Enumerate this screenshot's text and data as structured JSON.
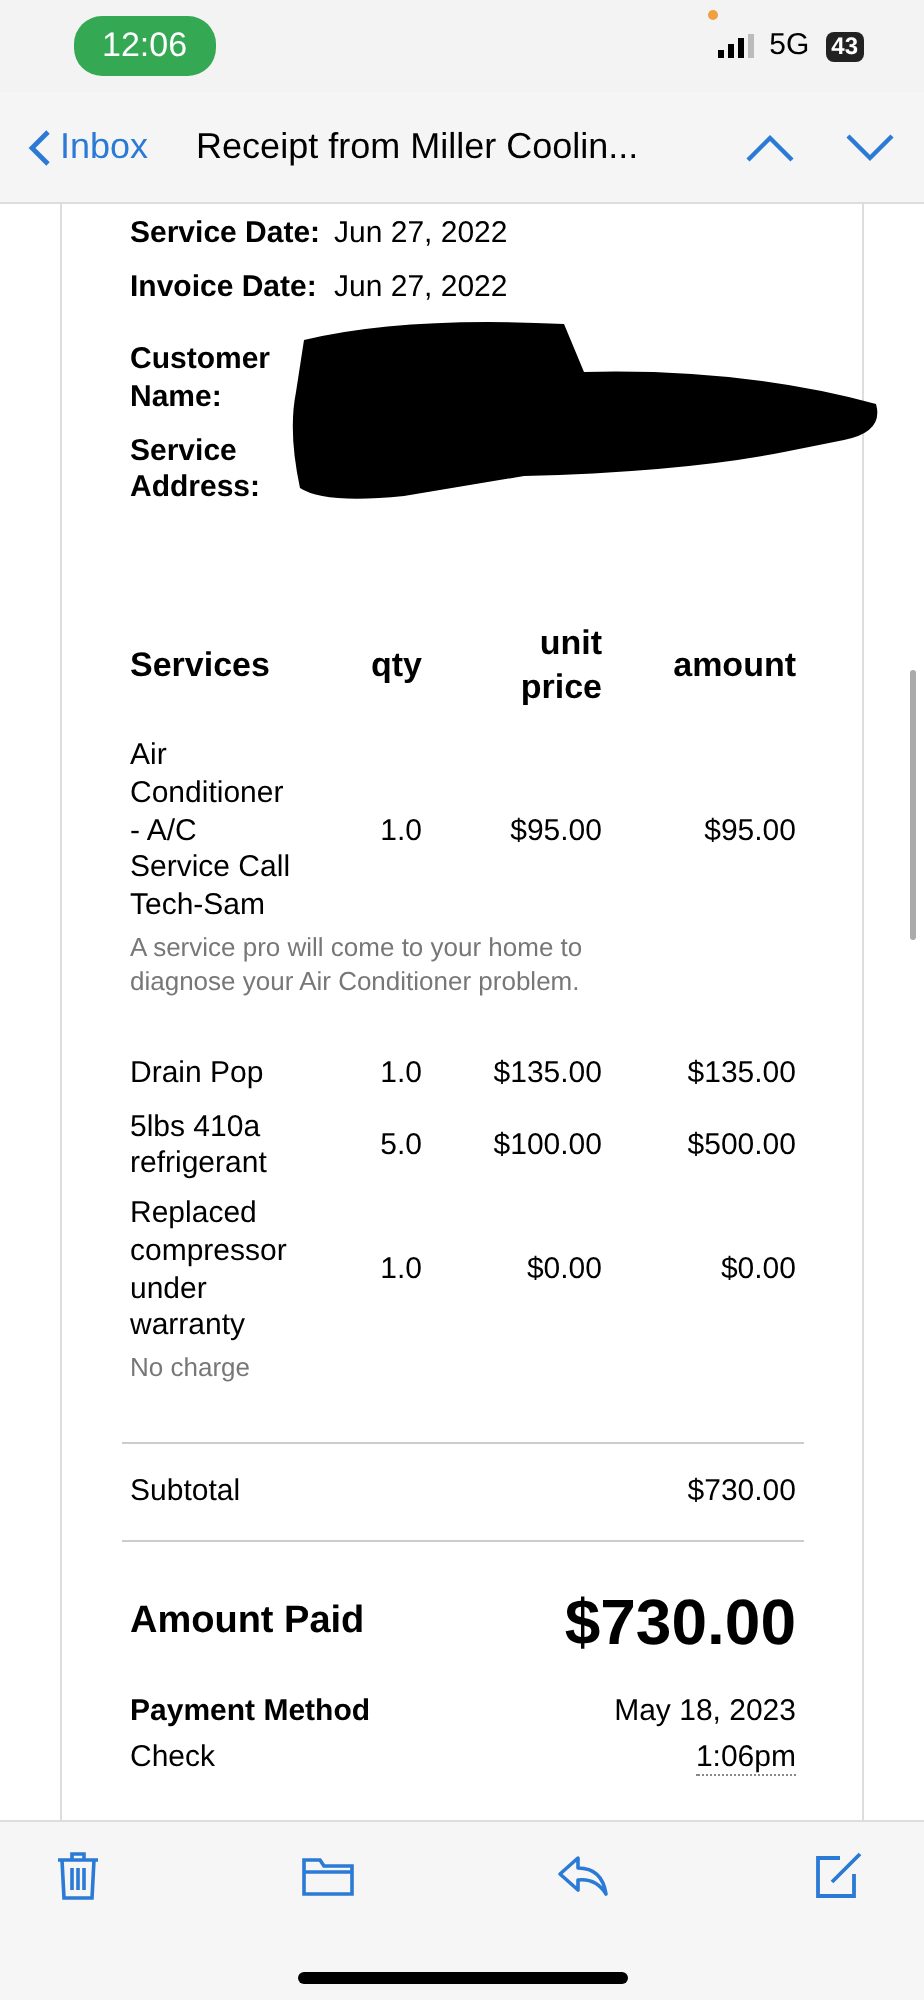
{
  "status_bar": {
    "time": "12:06",
    "network": "5G",
    "battery": "43"
  },
  "nav": {
    "back": "Inbox",
    "title": "Receipt from Miller Coolin..."
  },
  "dates": [
    {
      "label": "Service Date:",
      "value": "Jun 27, 2022"
    },
    {
      "label": "Invoice Date:",
      "value": "Jun 27, 2022"
    }
  ],
  "customer_labels": [
    "Customer Name:",
    "Service Address:"
  ],
  "table": {
    "columns": [
      "Services",
      "qty",
      "unit price",
      "amount"
    ],
    "rows": [
      {
        "name": "Air Conditioner - A/C Service Call Tech-Sam",
        "qty": "1.0",
        "unit_price": "$95.00",
        "amount": "$95.00",
        "note": "A service pro will come to your home to diagnose your Air Conditioner problem."
      },
      {
        "name": "Drain Pop",
        "qty": "1.0",
        "unit_price": "$135.00",
        "amount": "$135.00"
      },
      {
        "name": "5lbs 410a refrigerant",
        "qty": "5.0",
        "unit_price": "$100.00",
        "amount": "$500.00"
      },
      {
        "name": "Replaced compressor under warranty",
        "qty": "1.0",
        "unit_price": "$0.00",
        "amount": "$0.00",
        "note": "No charge"
      }
    ]
  },
  "subtotal": {
    "label": "Subtotal",
    "value": "$730.00"
  },
  "amount_paid": {
    "label": "Amount Paid",
    "value": "$730.00"
  },
  "payment": {
    "label": "Payment Method",
    "method": "Check",
    "date": "May 18, 2023",
    "time": "1:06pm"
  },
  "toolbar": [
    {
      "kind": "trash"
    },
    {
      "kind": "folder"
    },
    {
      "kind": "reply"
    },
    {
      "kind": "compose"
    }
  ]
}
